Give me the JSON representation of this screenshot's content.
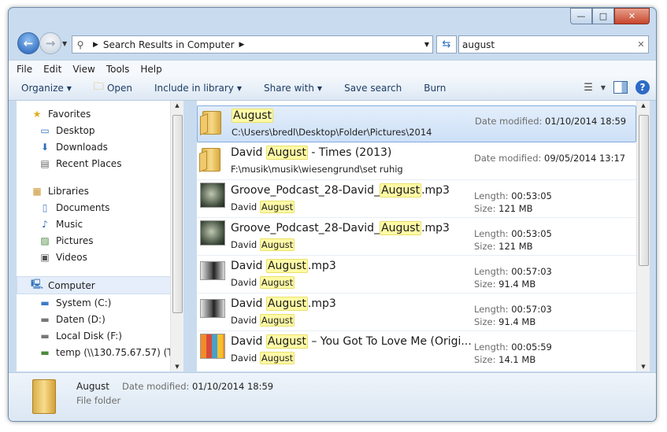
{
  "window": {
    "controls": {
      "minimize": "—",
      "maximize": "□",
      "close": "✕"
    }
  },
  "address": {
    "breadcrumb": "Search Results in Computer",
    "search_value": "august"
  },
  "menu": [
    "File",
    "Edit",
    "View",
    "Tools",
    "Help"
  ],
  "commands": {
    "organize": "Organize",
    "open": "Open",
    "include": "Include in library",
    "share": "Share with",
    "save_search": "Save search",
    "burn": "Burn"
  },
  "nav": {
    "favorites": "Favorites",
    "desktop": "Desktop",
    "downloads": "Downloads",
    "recent": "Recent Places",
    "libraries": "Libraries",
    "documents": "Documents",
    "music": "Music",
    "pictures": "Pictures",
    "videos": "Videos",
    "computer": "Computer",
    "system": "System (C:)",
    "daten": "Daten (D:)",
    "localf": "Local Disk (F:)",
    "temp": "temp (\\\\130.75.67.57) (T:)"
  },
  "labels": {
    "date_modified": "Date modified:",
    "length": "Length:",
    "size": "Size:"
  },
  "results": [
    {
      "pre": "",
      "hl": "August",
      "post": "",
      "sub_pre": "C:\\Users\\bredl\\Desktop\\Folder\\Pictures\\2014",
      "sub_hl": "",
      "m1": "01/10/2014 18:59",
      "m2": ""
    },
    {
      "pre": "David ",
      "hl": "August",
      "post": " - Times (2013)",
      "sub_pre": "F:\\musik\\musik\\wiesengrund\\set ruhig",
      "sub_hl": "",
      "m1": "09/05/2014 13:17",
      "m2": ""
    },
    {
      "pre": "Groove_Podcast_28-David_",
      "hl": "August",
      "post": ".mp3",
      "sub_pre": "David ",
      "sub_hl": "August",
      "m1": "00:53:05",
      "m2": "121 MB"
    },
    {
      "pre": "Groove_Podcast_28-David_",
      "hl": "August",
      "post": ".mp3",
      "sub_pre": "David ",
      "sub_hl": "August",
      "m1": "00:53:05",
      "m2": "121 MB"
    },
    {
      "pre": "David ",
      "hl": "August",
      "post": ".mp3",
      "sub_pre": "David ",
      "sub_hl": "August",
      "m1": "00:57:03",
      "m2": "91.4 MB"
    },
    {
      "pre": "David ",
      "hl": "August",
      "post": ".mp3",
      "sub_pre": "David ",
      "sub_hl": "August",
      "m1": "00:57:03",
      "m2": "91.4 MB"
    },
    {
      "pre": "David ",
      "hl": "August",
      "post": " – You Got To Love Me (Origi...",
      "sub_pre": "David ",
      "sub_hl": "August",
      "m1": "00:05:59",
      "m2": "14.1 MB"
    }
  ],
  "details": {
    "name": "August",
    "type": "File folder",
    "date_label": "Date modified:",
    "date_value": "01/10/2014 18:59"
  },
  "colors": {
    "accent": "#2d6bc6",
    "highlight": "#fffaa6",
    "selection": "#cde0f7"
  }
}
